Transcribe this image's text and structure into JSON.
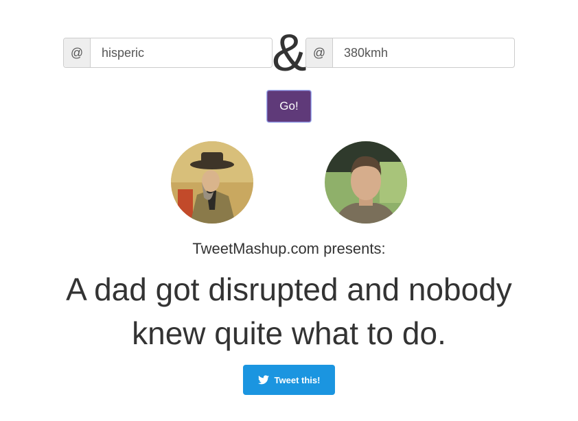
{
  "handle1": {
    "prefix": "@",
    "value": "hisperic"
  },
  "connector": "&",
  "handle2": {
    "prefix": "@",
    "value": "380kmh"
  },
  "go_label": "Go!",
  "presents": "TweetMashup.com presents:",
  "headline": "A dad got disrupted and nobody knew quite what to do.",
  "tweet_label": "Tweet this!",
  "colors": {
    "go_button": "#5f3a79",
    "tweet_button": "#1b95e0"
  },
  "icons": {
    "tweet": "twitter-bird-icon"
  }
}
